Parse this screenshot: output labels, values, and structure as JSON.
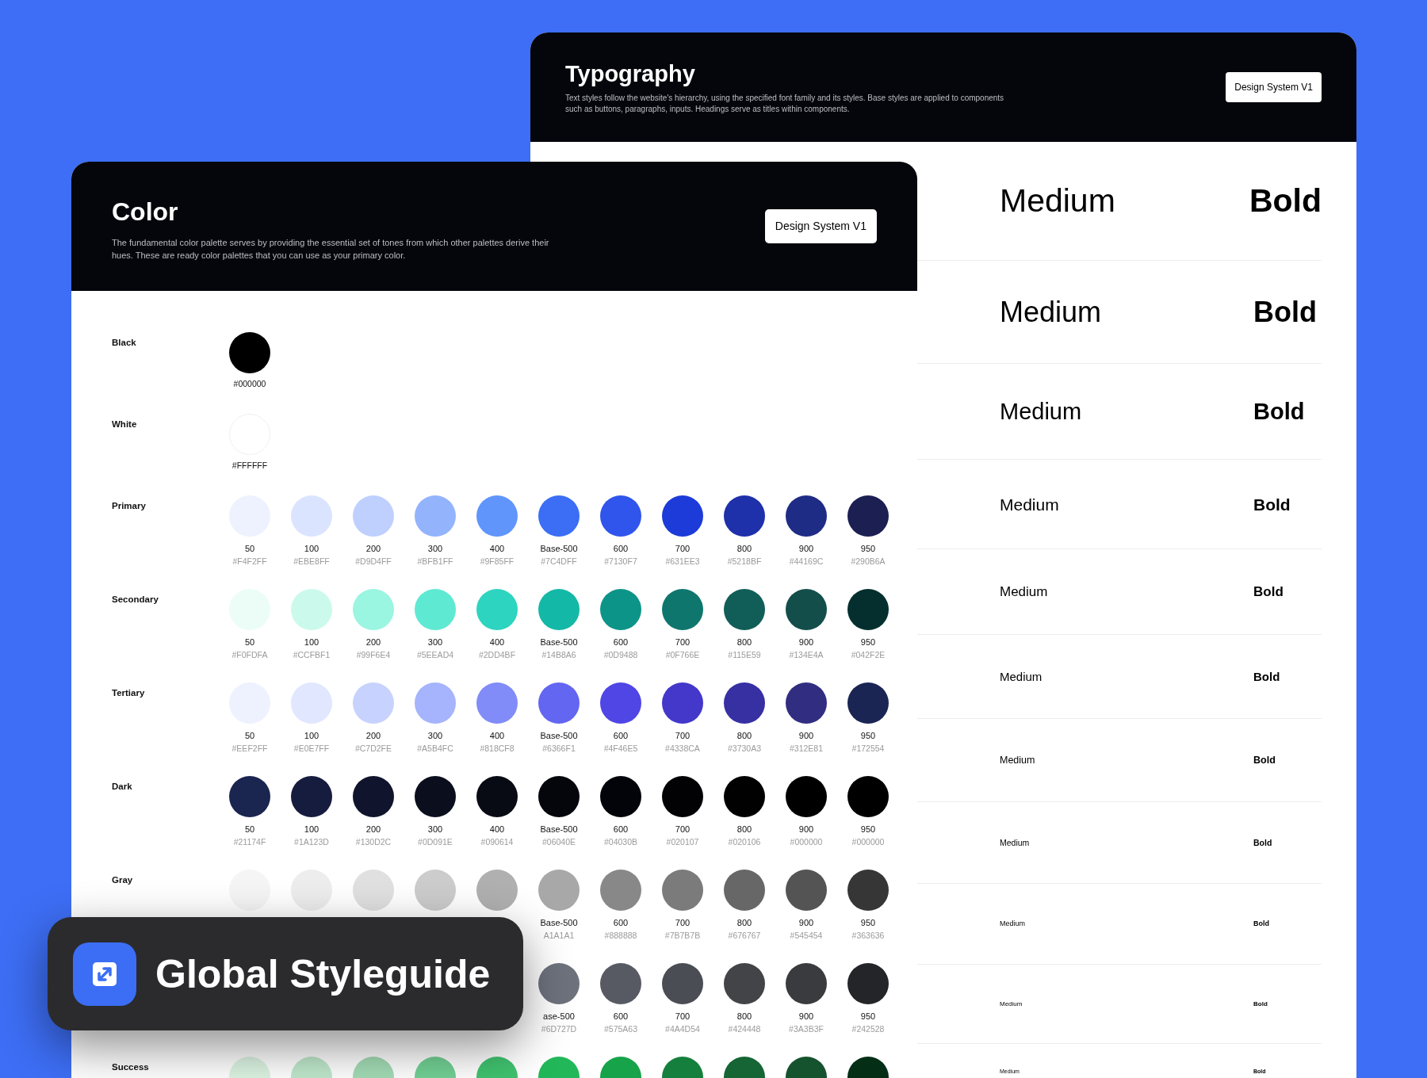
{
  "typography_panel": {
    "title": "Typography",
    "description": "Text styles follow the website's hierarchy, using the specified font family and its styles. Base styles are applied to components such as buttons, paragraphs, inputs. Headings serve as titles within components.",
    "badge": "Design System V1",
    "samples": [
      {
        "medium": "Medium",
        "bold": "Bold"
      },
      {
        "medium": "Medium",
        "bold": "Bold"
      },
      {
        "medium": "Medium",
        "bold": "Bold"
      },
      {
        "medium": "Medium",
        "bold": "Bold"
      },
      {
        "medium": "Medium",
        "bold": "Bold"
      },
      {
        "medium": "Medium",
        "bold": "Bold"
      },
      {
        "medium": "Medium",
        "bold": "Bold"
      },
      {
        "medium": "Medium",
        "bold": "Bold"
      },
      {
        "medium": "Medium",
        "bold": "Bold"
      },
      {
        "medium": "Medium",
        "bold": "Bold"
      },
      {
        "medium": "Medium",
        "bold": "Bold"
      }
    ]
  },
  "color_panel": {
    "title": "Color",
    "description": "The fundamental color palette serves by providing the essential set of tones from which other palettes derive their hues. These are ready color palettes that you can use as your primary color.",
    "badge": "Design System V1",
    "rows": [
      {
        "name": "Black",
        "kind": "single",
        "swatches": [
          {
            "hex": "#000000",
            "color": "#000000"
          }
        ]
      },
      {
        "name": "White",
        "kind": "single",
        "swatches": [
          {
            "hex": "#FFFFFF",
            "color": "#ffffff"
          }
        ]
      },
      {
        "name": "Primary",
        "kind": "palette",
        "swatches": [
          {
            "step": "50",
            "hex": "#F4F2FF",
            "color": "#eef2ff"
          },
          {
            "step": "100",
            "hex": "#EBE8FF",
            "color": "#dbe4ff"
          },
          {
            "step": "200",
            "hex": "#D9D4FF",
            "color": "#bfd0ff"
          },
          {
            "step": "300",
            "hex": "#BFB1FF",
            "color": "#93b4fd"
          },
          {
            "step": "400",
            "hex": "#9F85FF",
            "color": "#6095fb"
          },
          {
            "step": "Base-500",
            "hex": "#7C4DFF",
            "color": "#3b6ef5"
          },
          {
            "step": "600",
            "hex": "#7130F7",
            "color": "#2f55ec"
          },
          {
            "step": "700",
            "hex": "#631EE3",
            "color": "#1c3bd8"
          },
          {
            "step": "800",
            "hex": "#5218BF",
            "color": "#1f30ab"
          },
          {
            "step": "900",
            "hex": "#44169C",
            "color": "#1f2c86"
          },
          {
            "step": "950",
            "hex": "#290B6A",
            "color": "#1b1f52"
          }
        ]
      },
      {
        "name": "Secondary",
        "kind": "palette",
        "swatches": [
          {
            "step": "50",
            "hex": "#F0FDFA",
            "color": "#ecfdf7"
          },
          {
            "step": "100",
            "hex": "#CCFBF1",
            "color": "#cbfaec"
          },
          {
            "step": "200",
            "hex": "#99F6E4",
            "color": "#9af5e1"
          },
          {
            "step": "300",
            "hex": "#5EEAD4",
            "color": "#5ee9d3"
          },
          {
            "step": "400",
            "hex": "#2DD4BF",
            "color": "#2dd4bf"
          },
          {
            "step": "Base-500",
            "hex": "#14B8A6",
            "color": "#14b8a6"
          },
          {
            "step": "600",
            "hex": "#0D9488",
            "color": "#0d9488"
          },
          {
            "step": "700",
            "hex": "#0F766E",
            "color": "#0f766e"
          },
          {
            "step": "800",
            "hex": "#115E59",
            "color": "#115e59"
          },
          {
            "step": "900",
            "hex": "#134E4A",
            "color": "#134e4a"
          },
          {
            "step": "950",
            "hex": "#042F2E",
            "color": "#042f2e"
          }
        ]
      },
      {
        "name": "Tertiary",
        "kind": "palette",
        "swatches": [
          {
            "step": "50",
            "hex": "#EEF2FF",
            "color": "#eef2ff"
          },
          {
            "step": "100",
            "hex": "#E0E7FF",
            "color": "#e0e7ff"
          },
          {
            "step": "200",
            "hex": "#C7D2FE",
            "color": "#c7d2fe"
          },
          {
            "step": "300",
            "hex": "#A5B4FC",
            "color": "#a5b4fc"
          },
          {
            "step": "400",
            "hex": "#818CF8",
            "color": "#818cf8"
          },
          {
            "step": "Base-500",
            "hex": "#6366F1",
            "color": "#6366f1"
          },
          {
            "step": "600",
            "hex": "#4F46E5",
            "color": "#4f46e5"
          },
          {
            "step": "700",
            "hex": "#4338CA",
            "color": "#4338ca"
          },
          {
            "step": "800",
            "hex": "#3730A3",
            "color": "#3730a3"
          },
          {
            "step": "900",
            "hex": "#312E81",
            "color": "#312e81"
          },
          {
            "step": "950",
            "hex": "#172554",
            "color": "#1a2554"
          }
        ]
      },
      {
        "name": "Dark",
        "kind": "palette",
        "swatches": [
          {
            "step": "50",
            "hex": "#21174F",
            "color": "#1a2550"
          },
          {
            "step": "100",
            "hex": "#1A123D",
            "color": "#161c3d"
          },
          {
            "step": "200",
            "hex": "#130D2C",
            "color": "#10142c"
          },
          {
            "step": "300",
            "hex": "#0D091E",
            "color": "#0b0e1d"
          },
          {
            "step": "400",
            "hex": "#090614",
            "color": "#080b14"
          },
          {
            "step": "Base-500",
            "hex": "#06040E",
            "color": "#05060c"
          },
          {
            "step": "600",
            "hex": "#04030B",
            "color": "#030409"
          },
          {
            "step": "700",
            "hex": "#020107",
            "color": "#020204"
          },
          {
            "step": "800",
            "hex": "#020106",
            "color": "#010102"
          },
          {
            "step": "900",
            "hex": "#000000",
            "color": "#000000"
          },
          {
            "step": "950",
            "hex": "#000000",
            "color": "#000001"
          }
        ]
      },
      {
        "name": "Gray",
        "kind": "palette",
        "swatches": [
          {
            "color": "#f5f5f5"
          },
          {
            "color": "#ededed"
          },
          {
            "color": "#e0e0e0"
          },
          {
            "color": "#cccccc"
          },
          {
            "color": "#b0b0b0"
          },
          {
            "step": "Base-500",
            "hex": "A1A1A1",
            "color": "#a8a8a8"
          },
          {
            "step": "600",
            "hex": "#888888",
            "color": "#888888"
          },
          {
            "step": "700",
            "hex": "#7B7B7B",
            "color": "#7b7b7b"
          },
          {
            "step": "800",
            "hex": "#676767",
            "color": "#676767"
          },
          {
            "step": "900",
            "hex": "#545454",
            "color": "#545454"
          },
          {
            "step": "950",
            "hex": "#363636",
            "color": "#363636"
          }
        ]
      },
      {
        "kind": "palette",
        "swatches": [
          {
            "kind": "covered"
          },
          {
            "kind": "covered"
          },
          {
            "kind": "covered"
          },
          {
            "kind": "covered"
          },
          {
            "kind": "covered"
          },
          {
            "kind": "circle",
            "step": "ase-500",
            "hex": "#6D727D",
            "color": "#6d727d"
          },
          {
            "kind": "circle",
            "step": "600",
            "hex": "#575A63",
            "color": "#575a63"
          },
          {
            "kind": "circle",
            "step": "700",
            "hex": "#4A4D54",
            "color": "#4a4d54"
          },
          {
            "kind": "circle",
            "step": "800",
            "hex": "#424448",
            "color": "#424448"
          },
          {
            "kind": "circle",
            "step": "900",
            "hex": "#3A3B3F",
            "color": "#3a3b3f"
          },
          {
            "kind": "circle",
            "step": "950",
            "hex": "#242528",
            "color": "#242528"
          }
        ]
      },
      {
        "name": "Success",
        "kind": "palette",
        "swatches": [
          {
            "color": "#dcf4e2"
          },
          {
            "color": "#bfe8cb"
          },
          {
            "color": "#a3dcb5"
          },
          {
            "color": "#72d094"
          },
          {
            "color": "#40c26f"
          },
          {
            "color": "#22b859"
          },
          {
            "color": "#17a34a"
          },
          {
            "color": "#15803d"
          },
          {
            "color": "#166534"
          },
          {
            "color": "#14532d"
          },
          {
            "color": "#052e16"
          }
        ]
      }
    ]
  },
  "overlay": {
    "title": "Global Styleguide"
  }
}
